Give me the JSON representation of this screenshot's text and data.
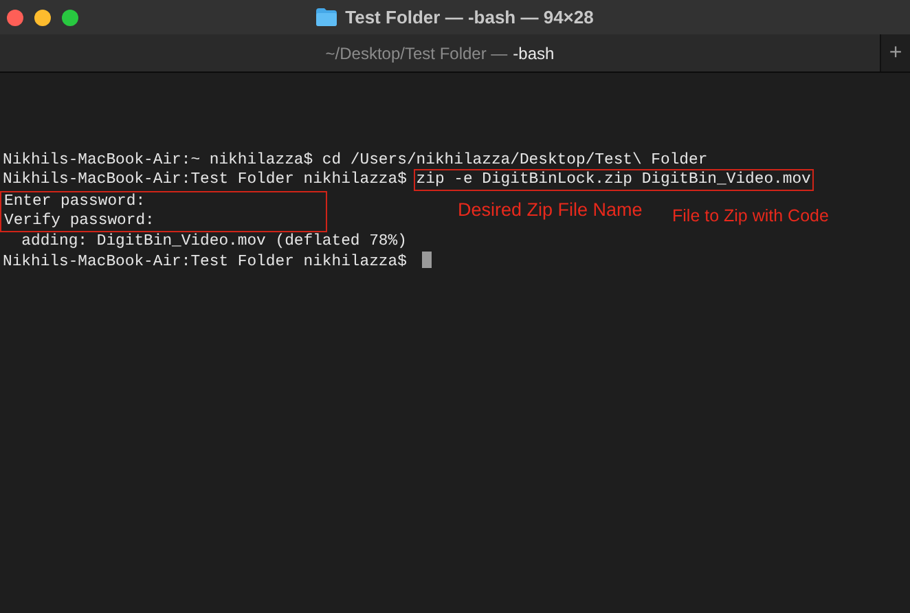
{
  "window": {
    "title": "Test Folder — -bash — 94×28"
  },
  "tab": {
    "path": "~/Desktop/Test Folder —",
    "process": "-bash",
    "new_tab": "+"
  },
  "terminal": {
    "lines": [
      {
        "prompt": "Nikhils-MacBook-Air:~ nikhilazza$",
        "command": "cd /Users/nikhilazza/Desktop/Test\\ Folder"
      },
      {
        "prompt": "Nikhils-MacBook-Air:Test Folder nikhilazza$",
        "command": "zip -e DigitBinLock.zip DigitBin_Video.mov",
        "command_boxed": true
      },
      {
        "output": "Enter password:",
        "boxed": true
      },
      {
        "output": "Verify password:",
        "boxed": true
      },
      {
        "output": "  adding: DigitBin_Video.mov (deflated 78%)"
      },
      {
        "prompt": "Nikhils-MacBook-Air:Test Folder nikhilazza$",
        "cursor": true
      }
    ]
  },
  "annotations": [
    {
      "text": "Desired Zip File Name"
    },
    {
      "text": "File to Zip with Code"
    }
  ]
}
